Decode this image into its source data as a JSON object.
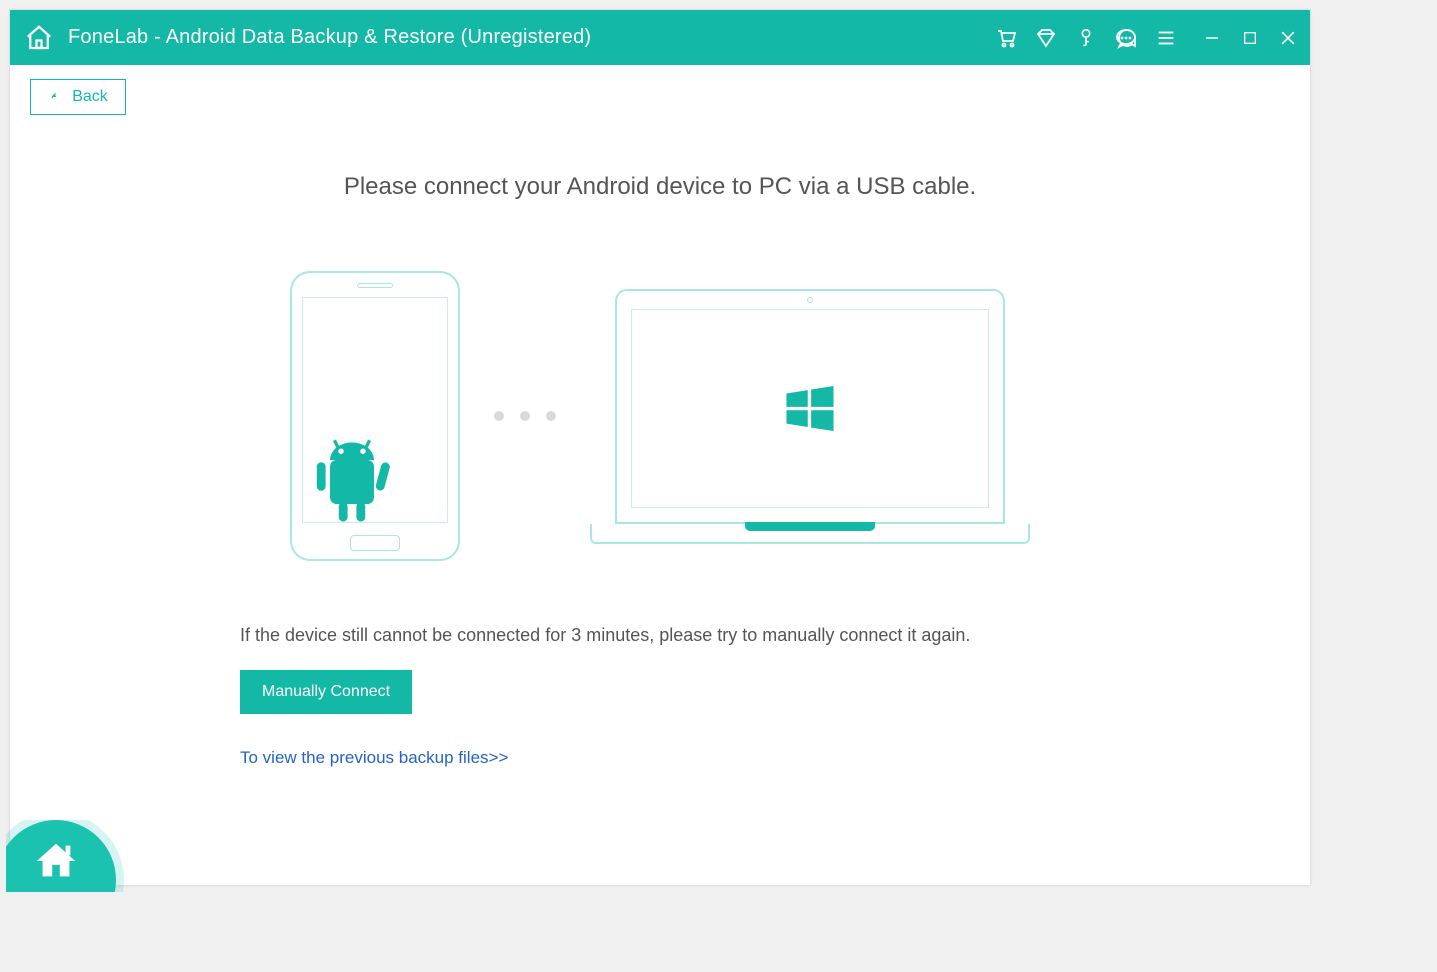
{
  "titlebar": {
    "title": "FoneLab - Android Data Backup & Restore (Unregistered)"
  },
  "nav": {
    "back_label": "Back"
  },
  "main": {
    "headline": "Please connect your Android device to PC via a USB cable.",
    "hint": "If the device still cannot be connected for 3 minutes, please try to manually connect it again.",
    "manual_connect_label": "Manually Connect",
    "view_previous_label": "To view the previous backup files>>"
  },
  "icons": {
    "cart": "cart-icon",
    "diamond": "diamond-icon",
    "key": "key-icon",
    "chat": "chat-icon",
    "menu": "menu-icon",
    "minimize": "minimize-icon",
    "maximize": "maximize-icon",
    "close": "close-icon",
    "home": "home-icon",
    "android": "android-icon",
    "windows": "windows-icon"
  },
  "colors": {
    "accent": "#14b8a6",
    "outline": "#a7e8df",
    "link": "#2563c9",
    "text": "#555555"
  }
}
